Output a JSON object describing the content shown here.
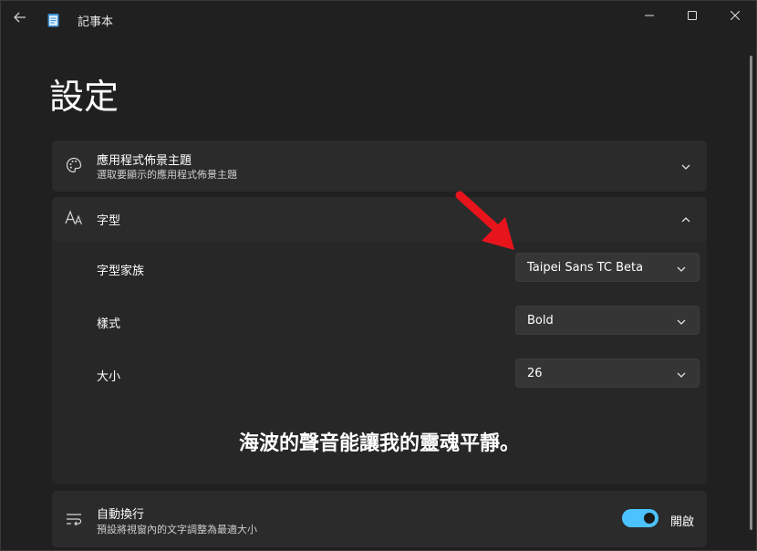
{
  "window": {
    "title": "記事本",
    "back_icon": "arrow-left-icon",
    "app_icon": "notepad-icon",
    "controls": [
      "minimize-icon",
      "maximize-icon",
      "close-icon"
    ]
  },
  "page": {
    "title": "設定"
  },
  "theme_card": {
    "icon": "palette-icon",
    "title": "應用程式佈景主題",
    "subtitle": "選取要顯示的應用程式佈景主題"
  },
  "font_card": {
    "icon": "font-icon",
    "title": "字型",
    "expanded": true,
    "family": {
      "label": "字型家族",
      "value": "Taipei Sans TC Beta"
    },
    "style": {
      "label": "樣式",
      "value": "Bold"
    },
    "size": {
      "label": "大小",
      "value": "26"
    },
    "preview": "海波的聲音能讓我的靈魂平靜。"
  },
  "wrap_card": {
    "icon": "word-wrap-icon",
    "title": "自動換行",
    "subtitle": "預設將視窗內的文字調整為最適大小",
    "toggle_on": true,
    "toggle_label": "開啟"
  },
  "colors": {
    "accent": "#4cc2ff",
    "annotation_arrow": "#e8141c",
    "background": "#202020",
    "card": "#2b2b2b"
  }
}
